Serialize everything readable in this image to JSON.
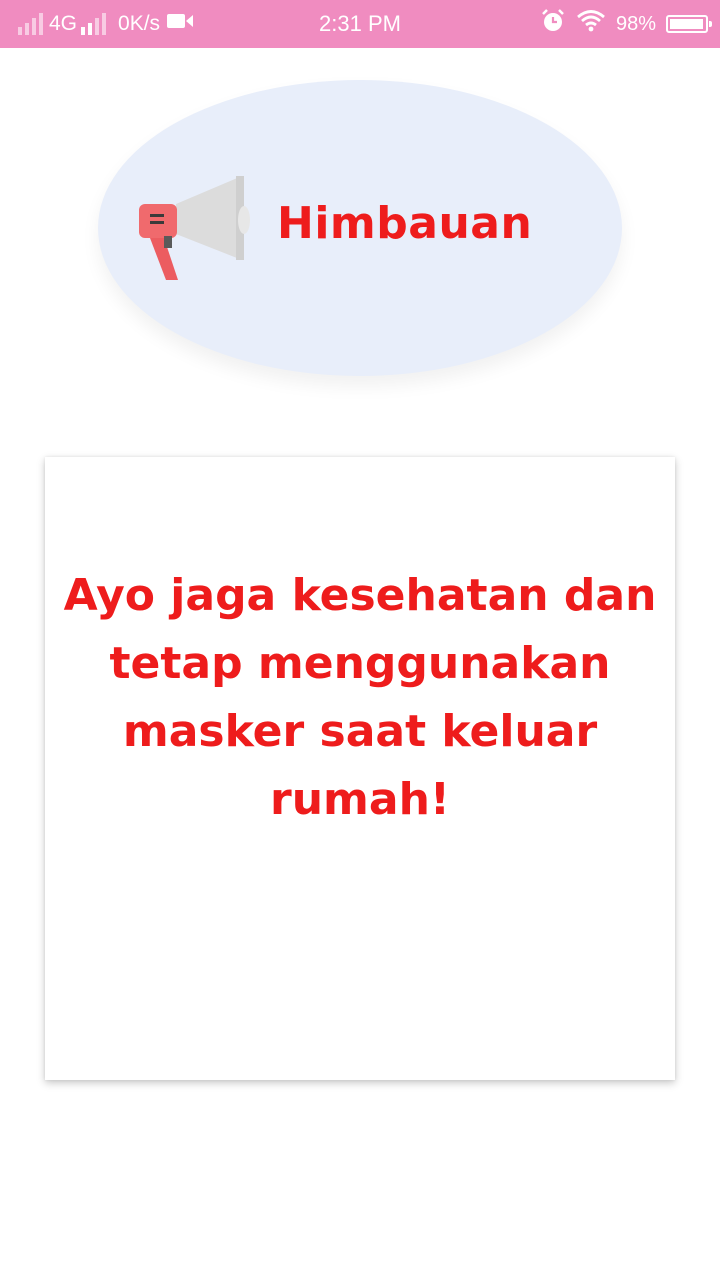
{
  "status_bar": {
    "network": "4G",
    "speed": "0K/s",
    "time": "2:31 PM",
    "battery_percent": "98%",
    "battery_level": 0.98,
    "icons": [
      "signal-icon",
      "signal-icon",
      "video-camera-icon",
      "alarm-icon",
      "wifi-icon",
      "battery-icon"
    ]
  },
  "header": {
    "title": "Himbauan",
    "icon": "megaphone-icon",
    "title_color": "#ee1c1c",
    "ellipse_color": "#e8eefa"
  },
  "card": {
    "message": "Ayo jaga kesehatan dan tetap menggunakan masker saat keluar rumah!",
    "text_color": "#ee1c1c"
  },
  "colors": {
    "status_bar": "#f08cc0",
    "background": "#ffffff"
  }
}
